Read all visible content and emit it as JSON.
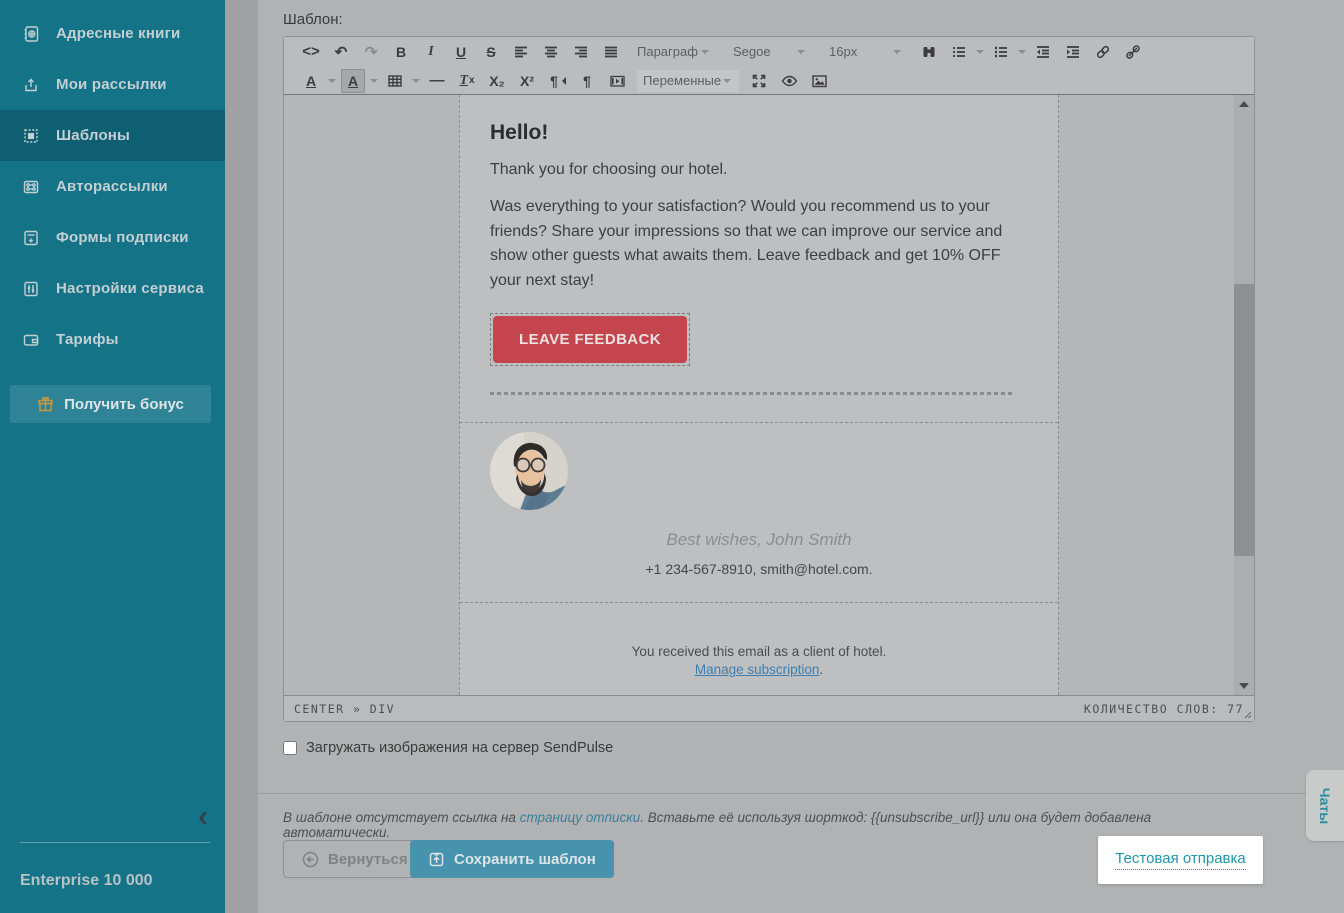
{
  "colors": {
    "sidebar-bg": "#147387",
    "sidebar-active": "#0d5f71",
    "bonus-bg": "#2e8496",
    "gift-gold": "#c9973b",
    "accent-red": "#c4454e",
    "save-blue": "#4792ad",
    "link-teal": "#1e96ab",
    "link-blue": "#3d7fb0",
    "note-link": "#3a7e9e"
  },
  "sidebar": {
    "items": [
      {
        "label": "Адресные книги",
        "icon": "address-book-icon"
      },
      {
        "label": "Мои рассылки",
        "icon": "campaigns-icon"
      },
      {
        "label": "Шаблоны",
        "icon": "templates-icon",
        "active": true
      },
      {
        "label": "Авторассылки",
        "icon": "automations-icon"
      },
      {
        "label": "Формы подписки",
        "icon": "subscription-forms-icon"
      },
      {
        "label": "Настройки сервиса",
        "icon": "service-settings-icon"
      },
      {
        "label": "Тарифы",
        "icon": "pricing-icon"
      }
    ],
    "bonus_button": "Получить бонус",
    "collapse_glyph": "‹",
    "plan": "Enterprise 10 000"
  },
  "editor": {
    "label": "Шаблон:",
    "toolbar": {
      "glyphs": {
        "code": "<>",
        "undo": "↶",
        "redo": "↷",
        "bold": "B",
        "italic": "I",
        "underline": "U",
        "strike": "S",
        "color_letter": "A",
        "hr": "—",
        "clear": "T",
        "clear_x": "x",
        "subscript": "X₂",
        "superscript": "X²",
        "pilcrow": "¶"
      },
      "paragraph_dropdown": "Параграф",
      "font_dropdown": "Segoe",
      "size_dropdown": "16px",
      "variables_dropdown": "Переменные"
    },
    "statusbar": {
      "path": "CENTER » DIV",
      "word_count_label": "КОЛИЧЕСТВО СЛОВ:",
      "word_count": "77"
    }
  },
  "email": {
    "heading": "Hello!",
    "para1": "Thank you for choosing our hotel.",
    "para2": "Was everything to your satisfaction? Would you recommend us to your friends? Share your impressions so that we can improve our service and show other guests what awaits them. Leave feedback and get 10% OFF your next stay!",
    "button": "LEAVE FEEDBACK",
    "signature": "Best wishes, John Smith",
    "contacts": "+1 234-567-8910, smith@hotel.com.",
    "footer_line1": "You received this email as a client of hotel.",
    "footer_link": "Manage subscription",
    "footer_period": "."
  },
  "bottom": {
    "upload_checkbox": "Загружать изображения на сервер SendPulse",
    "note_pre": "В шаблоне отсутствует ссылка на ",
    "note_link": "страницу отписки",
    "note_post": ". Вставьте её используя шорткод: {{unsubscribe_url}} или она будет добавлена автоматически.",
    "back_button": "Вернуться",
    "save_button": "Сохранить шаблон",
    "test_link": "Тестовая отправка"
  },
  "chats_tab": "Чаты"
}
